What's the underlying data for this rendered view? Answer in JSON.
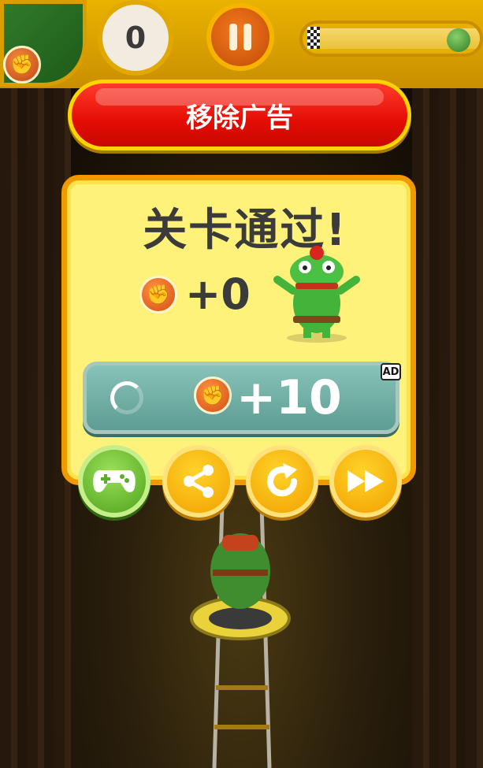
{
  "hud": {
    "score": "0"
  },
  "remove_ads": {
    "label": "移除广告"
  },
  "panel": {
    "title": "关卡通过!",
    "reward": "+0",
    "bonus": {
      "label": "+10",
      "ad_badge": "AD"
    }
  },
  "icons": {
    "coin": "fist-coin-icon",
    "games": "gamepad-icon",
    "share": "share-icon",
    "replay": "replay-icon",
    "next": "fast-forward-icon"
  },
  "colors": {
    "remove_ads": "#e40d04",
    "panel_bg": "#fff27a",
    "panel_border": "#f09a00",
    "bonus_button": "#6aa89e",
    "games_button": "#5aaf25",
    "yellow_buttons": "#f6b400"
  }
}
